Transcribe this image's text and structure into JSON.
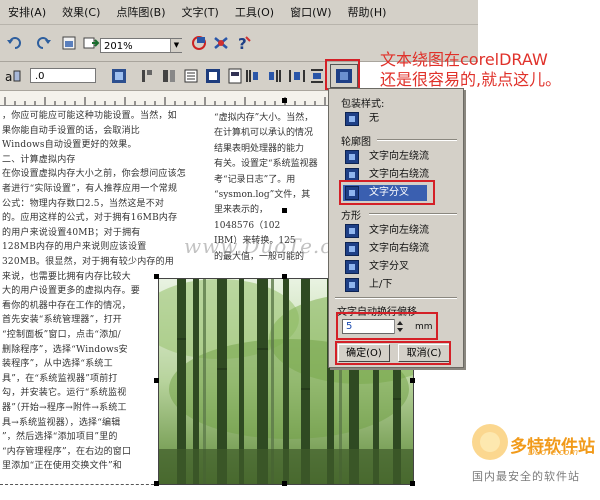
{
  "menu": [
    "安排(A)",
    "效果(C)",
    "点阵图(B)",
    "文字(T)",
    "工具(O)",
    "窗口(W)",
    "帮助(H)"
  ],
  "toolbar": {
    "zoom": "201%"
  },
  "property_bar": {
    "offset_value": ".0"
  },
  "annotation": {
    "line1": "文本绕图在corelDRAW",
    "line2": "还是很容易的,就点这儿。"
  },
  "panel": {
    "wrap_style_title": "包装样式:",
    "none_label": "无",
    "contour_title": "轮廓图",
    "contour_items": [
      "文字向左绕流",
      "文字向右绕流",
      "文字分叉"
    ],
    "square_title": "方形",
    "square_items": [
      "文字向左绕流",
      "文字向右绕流",
      "文字分叉",
      "上/下"
    ],
    "offset_title": "文字自动换行偏移",
    "offset_value": "5",
    "offset_unit": "mm",
    "ok_label": "确定(O)",
    "cancel_label": "取消(C)"
  },
  "document": {
    "left_lines": [
      "，你应可能应可能这种功能设置。当然，如",
      "果你能自动手设置的话，会取消比",
      "Windows自动设置更好的效果。",
      "二、计算虚拟内存",
      "在你设置虚拟内存大小之前，你会想问应该怎",
      "者进行“实际设置”，有人推荐应用一个常规",
      "公式：物理内存数口2.5，当然这是不对",
      "的。应用这样的公式，对于拥有16MB内存",
      "的用户来说设置40MB；对于拥有",
      "128MB内存的用户来说则应该设置",
      "320MB。很显然，对于拥有较少内存的用",
      "来说，也需要比拥有内存比较大",
      "大的用户设置更多的虚拟内存。要",
      "看你的机器中存在工作的情况，",
      "首先安装“系统管理器”，打开",
      "“控制面板”窗口，点击“添加/",
      "删除程序”，选择“Windows安",
      "装程序”，从中选择“系统工",
      "具”，在“系统监视器”项前打",
      "勾，并安装它。运行“系统监视",
      "器”（开始→程序→附件→系统工",
      "具→系统监视器），选择“编辑",
      "”，然后选择“添加项目”里的",
      "“内存管理程序”，在右边的窗口",
      "里添加“正在使用交换文件”和"
    ],
    "right_lines": [
      "“虚拟内存”大小。当然，",
      "在计算机可以承认的情况",
      "结果表明处理器的能力",
      "有关。设置定“系统监视器",
      "考“记录日志”了。用",
      "“sysmon.log”文件，其",
      "里来表示的，",
      "1048576（102",
      "IBM）来转换。125",
      "的最大值，一般可能的"
    ]
  },
  "watermark": "www.DuoTe.com",
  "logo": {
    "main": "多特软件站",
    "sub": "DuoTe.com",
    "bottom": "国内最安全的软件站"
  }
}
